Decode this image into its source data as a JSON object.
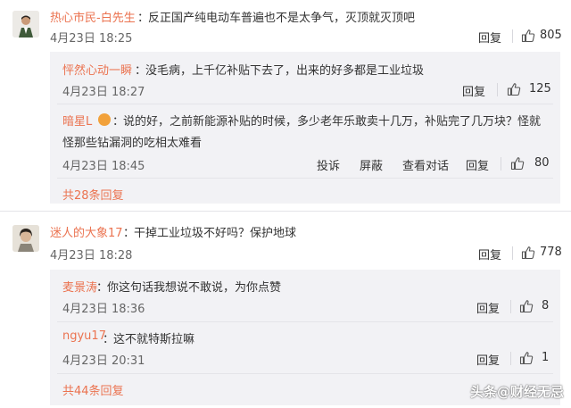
{
  "comments": [
    {
      "user": "热心市民-白先生",
      "text": "反正国产纯电动车普遍也不是太争气，灭顶就灭顶吧",
      "time": "4月23日 18:25",
      "reply_label": "回复",
      "likes": "805",
      "replies": [
        {
          "user": "怦然心动一瞬",
          "text": "没毛病，上千亿补贴下去了，出来的好多都是工业垃圾",
          "time": "4月23日 18:27",
          "reply_label": "回复",
          "likes": "125"
        },
        {
          "user": "暗星L",
          "text_line1": "说的好，之前新能源补贴的时候，多少老年乐敢卖十几万，补贴完了几万块？怪就",
          "text_line2": "怪那些钻漏洞的吃相太难看",
          "time": "4月23日 18:45",
          "report_label": "投诉",
          "block_label": "屏蔽",
          "view_conversation_label": "查看对话",
          "reply_label": "回复",
          "likes": "80"
        }
      ],
      "more_replies": "共28条回复"
    },
    {
      "user": "迷人的大象17",
      "text": "干掉工业垃圾不好吗？保护地球",
      "time": "4月23日 18:28",
      "reply_label": "回复",
      "likes": "778",
      "replies": [
        {
          "user": "麦景涛",
          "text": "你这句话我想说不敢说，为你点赞",
          "time": "4月23日 18:36",
          "reply_label": "回复",
          "likes": "8"
        },
        {
          "user": "ngyu17",
          "text": "这不就特斯拉嘛",
          "time": "4月23日 20:31",
          "reply_label": "回复",
          "likes": "1"
        }
      ],
      "more_replies": "共44条回复"
    }
  ],
  "colon": "：",
  "watermark": "头条@财经无忌",
  "colors": {
    "username": "#eb7350",
    "sub_bg": "#f2f2f5",
    "text": "#333333",
    "time": "#666666"
  }
}
